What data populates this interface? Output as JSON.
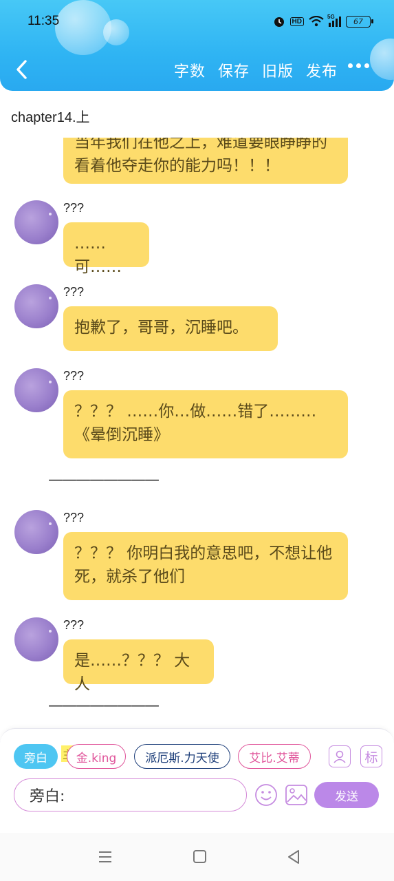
{
  "status_bar": {
    "time": "11:35",
    "hd": "HD",
    "network": "5G",
    "battery": "67"
  },
  "header": {
    "actions": [
      "字数",
      "保存",
      "旧版",
      "发布"
    ]
  },
  "chapter_title": "chapter14.上",
  "messages": [
    {
      "type": "bubble",
      "text": "当年我们在他之上，难道要眼睁睁的看着他夺走你的能力吗！！！"
    },
    {
      "type": "message",
      "speaker": "???",
      "text": "……可……"
    },
    {
      "type": "message",
      "speaker": "???",
      "text": "抱歉了，哥哥，沉睡吧。"
    },
    {
      "type": "message",
      "speaker": "???",
      "text": "？？？ ……你…做……错了………《晕倒沉睡》"
    },
    {
      "type": "divider",
      "text": "————————"
    },
    {
      "type": "message",
      "speaker": "???",
      "text": "？？？ 你明白我的意思吧，不想让他死，就杀了他们"
    },
    {
      "type": "message",
      "speaker": "???",
      "text": "是……？？？ 大人"
    },
    {
      "type": "divider",
      "text": "————————"
    }
  ],
  "composer": {
    "chips": {
      "narration": "旁白",
      "main_tag": "主",
      "gold": "金.king",
      "pai": "派厄斯.力天使",
      "ai": "艾比.艾蒂"
    },
    "mark_icon_label": "标",
    "input_value": "旁白:",
    "send_label": "发送"
  },
  "colors": {
    "header": "#2fb4f3",
    "bubble": "#fddc6c",
    "send": "#bb88e8",
    "narration_chip": "#4ec6f2"
  }
}
